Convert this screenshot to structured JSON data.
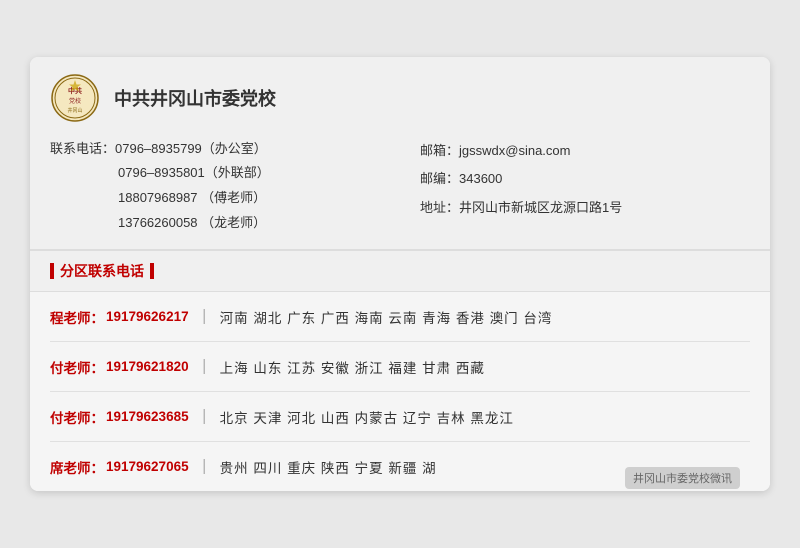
{
  "org": {
    "title": "中共井冈山市委党校",
    "contact_label": "联系电话：",
    "phones": [
      {
        "number": "0796–8935799",
        "note": "（办公室）"
      },
      {
        "number": "0796–8935801",
        "note": "（外联部）"
      },
      {
        "number": "18807968987",
        "note": "（傅老师）"
      },
      {
        "number": "13766260058",
        "note": "（龙老师）"
      }
    ],
    "email_label": "邮箱：",
    "email": "jgsswdx@sina.com",
    "postcode_label": "邮编：",
    "postcode": "343600",
    "address_label": "地址：",
    "address": "井冈山市新城区龙源口路1号"
  },
  "section": {
    "title": "分区联系电话"
  },
  "regions": [
    {
      "teacher": "程老师：",
      "phone": "19179626217",
      "areas": "河南  湖北  广东  广西  海南  云南  青海  香港  澳门  台湾"
    },
    {
      "teacher": "付老师：",
      "phone": "19179621820",
      "areas": "上海  山东  江苏  安徽  浙江  福建  甘肃  西藏"
    },
    {
      "teacher": "付老师：",
      "phone": "19179623685",
      "areas": "北京  天津  河北  山西  内蒙古  辽宁  吉林  黑龙江"
    },
    {
      "teacher": "席老师：",
      "phone": "19179627065",
      "areas": "贵州  四川  重庆  陕西  宁夏  新疆  湖..."
    }
  ],
  "watermark": "井冈山市委党校微讯"
}
